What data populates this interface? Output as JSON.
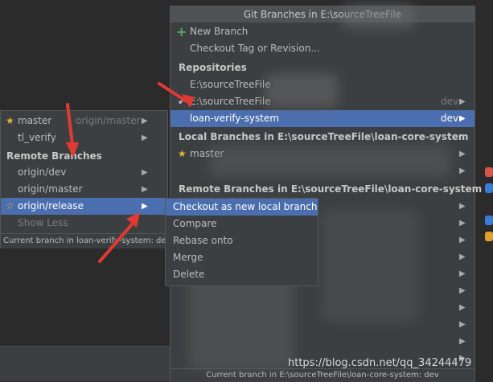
{
  "left_popup": {
    "items": [
      {
        "label": "master",
        "right": "origin/master"
      },
      {
        "label": "tl_verify",
        "right": ""
      }
    ],
    "remote_header": "Remote Branches",
    "remote_items": [
      "origin/dev",
      "origin/master",
      "origin/release"
    ],
    "show_less": "Show Less",
    "status": "Current branch in loan-verify-system: dev"
  },
  "submenu": {
    "items": [
      "Checkout as new local branch",
      "Compare",
      "Rebase onto",
      "Merge",
      "Delete"
    ]
  },
  "right_popup": {
    "title": "Git Branches in E:\\sourceTreeFile",
    "new_branch": "New Branch",
    "checkout_tag": "Checkout Tag or Revision...",
    "repos_header": "Repositories",
    "repos": [
      {
        "label": "E:\\sourceTreeFile",
        "right": ""
      },
      {
        "label": "E:\\sourceTreeFile",
        "right": "dev"
      },
      {
        "label": "loan-verify-system",
        "right": "dev"
      }
    ],
    "local_header": "Local Branches in E:\\sourceTreeFile\\loan-core-system",
    "local_items": [
      "master"
    ],
    "remote_header": "Remote Branches in E:\\sourceTreeFile\\loan-core-system",
    "status": "Current branch in E:\\sourceTreeFile\\loan-core-system: dev"
  },
  "watermark": "https://blog.csdn.net/qq_34244479",
  "colors": {
    "selection": "#4b6eaf",
    "accent_green": "#59a869",
    "star": "#e0b43c",
    "annotation": "#e23a32"
  }
}
